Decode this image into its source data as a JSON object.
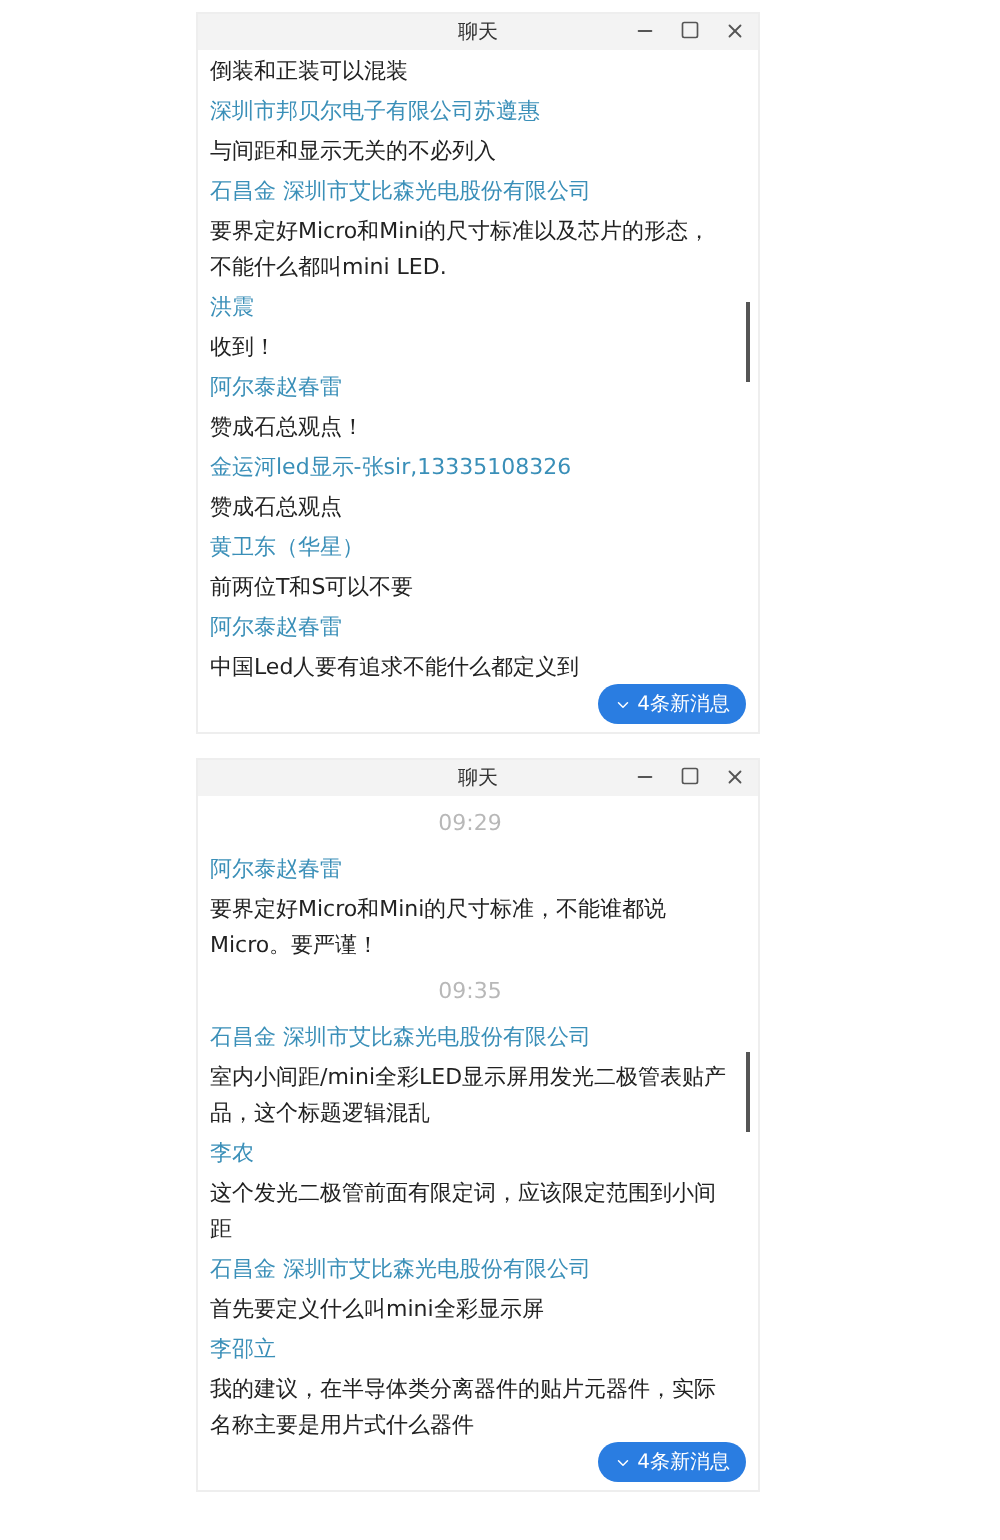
{
  "windows": [
    {
      "title": "聊天",
      "new_messages": "4条新消息",
      "messages": [
        {
          "kind": "text",
          "text": "倒装和正装可以混装"
        },
        {
          "kind": "name",
          "text": "深圳市邦贝尔电子有限公司苏遵惠"
        },
        {
          "kind": "text",
          "text": "与间距和显示无关的不必列入"
        },
        {
          "kind": "name",
          "text": "石昌金 深圳市艾比森光电股份有限公司"
        },
        {
          "kind": "text",
          "text": "要界定好Micro和Mini的尺寸标准以及芯片的形态，不能什么都叫mini LED."
        },
        {
          "kind": "name",
          "text": "洪震"
        },
        {
          "kind": "text",
          "text": "收到！"
        },
        {
          "kind": "name",
          "text": "阿尔泰赵春雷"
        },
        {
          "kind": "text",
          "text": "赞成石总观点！"
        },
        {
          "kind": "name",
          "text": "金运河led显示-张sir,13335108326"
        },
        {
          "kind": "text",
          "text": "赞成石总观点"
        },
        {
          "kind": "name",
          "text": "黄卫东（华星）"
        },
        {
          "kind": "text",
          "text": "前两位T和S可以不要"
        },
        {
          "kind": "name",
          "text": "阿尔泰赵春雷"
        },
        {
          "kind": "text",
          "text": "中国Led人要有追求不能什么都定义到"
        }
      ]
    },
    {
      "title": "聊天",
      "new_messages": "4条新消息",
      "messages": [
        {
          "kind": "time",
          "text": "09:29"
        },
        {
          "kind": "name",
          "text": "阿尔泰赵春雷"
        },
        {
          "kind": "text",
          "text": "要界定好Micro和Mini的尺寸标准，不能谁都说Micro。要严谨！"
        },
        {
          "kind": "time",
          "text": "09:35"
        },
        {
          "kind": "name",
          "text": "石昌金 深圳市艾比森光电股份有限公司"
        },
        {
          "kind": "text",
          "text": "室内小间距/mini全彩LED显示屏用发光二极管表贴产品，这个标题逻辑混乱"
        },
        {
          "kind": "name",
          "text": "李农"
        },
        {
          "kind": "text",
          "text": "这个发光二极管前面有限定词，应该限定范围到小间距"
        },
        {
          "kind": "name",
          "text": "石昌金 深圳市艾比森光电股份有限公司"
        },
        {
          "kind": "text",
          "text": "首先要定义什么叫mini全彩显示屏"
        },
        {
          "kind": "name",
          "text": "李邵立"
        },
        {
          "kind": "text",
          "text": "我的建议，在半导体类分离器件的贴片元器件，实际名称主要是用片式什么器件"
        }
      ]
    }
  ]
}
